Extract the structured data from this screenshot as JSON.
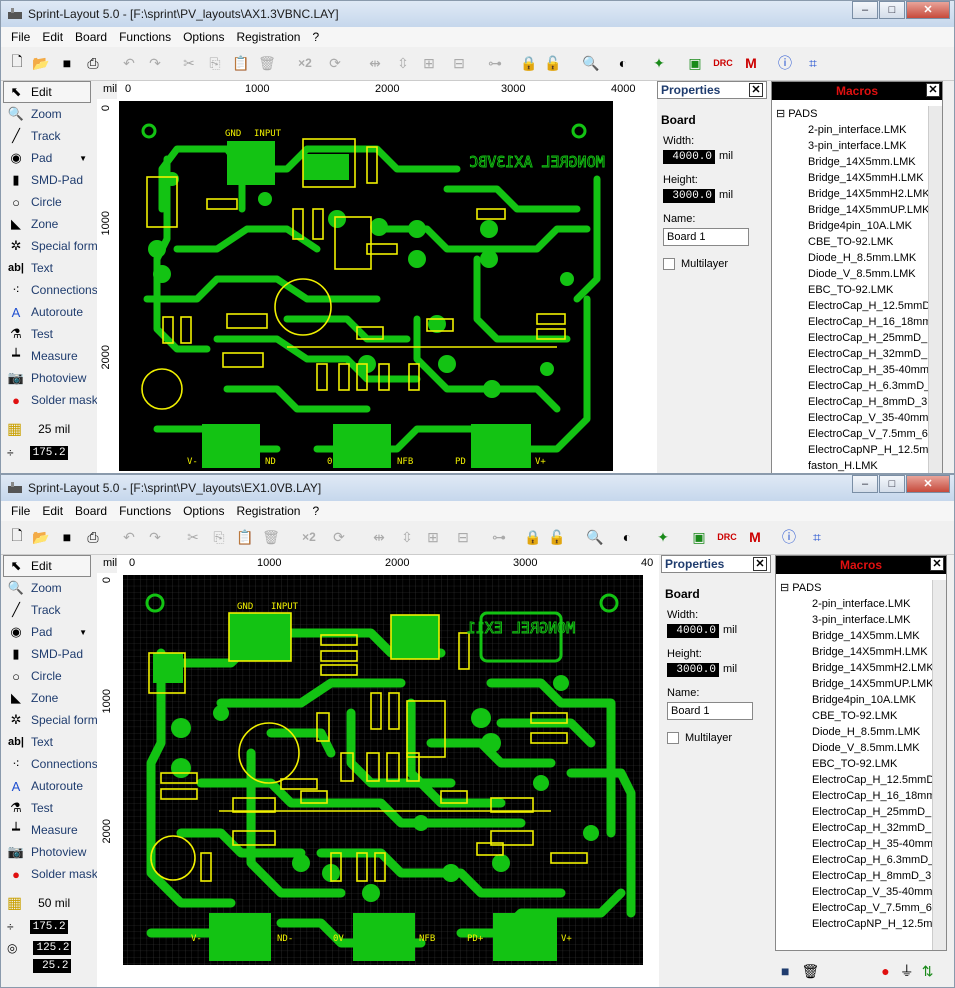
{
  "windows": [
    {
      "title": "Sprint-Layout 5.0 - [F:\\sprint\\PV_layouts\\AX1.3VBNC.LAY]",
      "menu": [
        "File",
        "Edit",
        "Board",
        "Functions",
        "Options",
        "Registration",
        "?"
      ],
      "tools": [
        {
          "label": "Edit",
          "icon": "arrow-cursor-icon"
        },
        {
          "label": "Zoom",
          "icon": "magnifier-icon"
        },
        {
          "label": "Track",
          "icon": "track-line-icon"
        },
        {
          "label": "Pad",
          "icon": "pad-icon"
        },
        {
          "label": "SMD-Pad",
          "icon": "smd-pad-icon"
        },
        {
          "label": "Circle",
          "icon": "circle-icon"
        },
        {
          "label": "Zone",
          "icon": "zone-icon"
        },
        {
          "label": "Special form",
          "icon": "special-form-icon"
        },
        {
          "label": "Text",
          "icon": "text-icon"
        },
        {
          "label": "Connections",
          "icon": "connections-icon"
        },
        {
          "label": "Autoroute",
          "icon": "autoroute-icon"
        },
        {
          "label": "Test",
          "icon": "test-icon"
        },
        {
          "label": "Measure",
          "icon": "measure-icon"
        },
        {
          "label": "Photoview",
          "icon": "camera-icon"
        },
        {
          "label": "Solder mask",
          "icon": "solder-mask-icon"
        }
      ],
      "grid": "25 mil",
      "track_width": "175.2",
      "ruler_unit": "mil",
      "hruler": [
        "0",
        "1000",
        "2000",
        "3000",
        "4000"
      ],
      "vruler": [
        "0",
        "1000",
        "2000"
      ],
      "properties": {
        "title": "Properties",
        "section": "Board",
        "width_label": "Width:",
        "width": "4000.0",
        "width_unit": "mil",
        "height_label": "Height:",
        "height": "3000.0",
        "height_unit": "mil",
        "name_label": "Name:",
        "name": "Board 1",
        "multilayer": "Multilayer"
      },
      "macros": {
        "title": "Macros",
        "root": "PADS",
        "items": [
          "2-pin_interface.LMK",
          "3-pin_interface.LMK",
          "Bridge_14X5mm.LMK",
          "Bridge_14X5mmH.LMK",
          "Bridge_14X5mmH2.LMK",
          "Bridge_14X5mmUP.LMK",
          "Bridge4pin_10A.LMK",
          "CBE_TO-92.LMK",
          "Diode_H_8.5mm.LMK",
          "Diode_V_8.5mm.LMK",
          "EBC_TO-92.LMK",
          "ElectroCap_H_12.5mmD",
          "ElectroCap_H_16_18mm",
          "ElectroCap_H_25mmD_",
          "ElectroCap_H_32mmD_",
          "ElectroCap_H_35-40mm",
          "ElectroCap_H_6.3mmD_",
          "ElectroCap_H_8mmD_3",
          "ElectroCap_V_35-40mm",
          "ElectroCap_V_7.5mm_6.",
          "ElectroCapNP_H_12.5m",
          "faston_H.LMK"
        ]
      },
      "pcb": {
        "top_labels": [
          "GND",
          "INPUT"
        ],
        "bottom_labels": [
          "V-",
          "ND",
          "0",
          "NFB",
          "PD",
          "V+"
        ],
        "mirror_text": "MONGREL AX13VBC"
      }
    },
    {
      "title": "Sprint-Layout 5.0 - [F:\\sprint\\PV_layouts\\EX1.0VB.LAY]",
      "menu": [
        "File",
        "Edit",
        "Board",
        "Functions",
        "Options",
        "Registration",
        "?"
      ],
      "grid": "50 mil",
      "track_width": "175.2",
      "val2": "125.2",
      "val3": "25.2",
      "ruler_unit": "mil",
      "hruler": [
        "0",
        "1000",
        "2000",
        "3000",
        "40"
      ],
      "vruler": [
        "0",
        "1000",
        "2000"
      ],
      "properties": {
        "title": "Properties",
        "section": "Board",
        "width_label": "Width:",
        "width": "4000.0",
        "width_unit": "mil",
        "height_label": "Height:",
        "height": "3000.0",
        "height_unit": "mil",
        "name_label": "Name:",
        "name": "Board 1",
        "multilayer": "Multilayer"
      },
      "macros": {
        "title": "Macros",
        "root": "PADS",
        "items": [
          "2-pin_interface.LMK",
          "3-pin_interface.LMK",
          "Bridge_14X5mm.LMK",
          "Bridge_14X5mmH.LMK",
          "Bridge_14X5mmH2.LMK",
          "Bridge_14X5mmUP.LMK",
          "Bridge4pin_10A.LMK",
          "CBE_TO-92.LMK",
          "Diode_H_8.5mm.LMK",
          "Diode_V_8.5mm.LMK",
          "EBC_TO-92.LMK",
          "ElectroCap_H_12.5mmD",
          "ElectroCap_H_16_18mm",
          "ElectroCap_H_25mmD_",
          "ElectroCap_H_32mmD_",
          "ElectroCap_H_35-40mm",
          "ElectroCap_H_6.3mmD_",
          "ElectroCap_H_8mmD_3",
          "ElectroCap_V_35-40mm",
          "ElectroCap_V_7.5mm_6.",
          "ElectroCapNP_H_12.5m"
        ]
      },
      "pcb": {
        "top_labels": [
          "GND",
          "INPUT"
        ],
        "bottom_labels": [
          "V-",
          "ND-",
          "0V",
          "NFB",
          "PD+",
          "V+"
        ],
        "mirror_text": "MONGREL EX11"
      }
    }
  ],
  "colors": {
    "copper": "#13c313",
    "silk": "#f0f000",
    "board": "#000000",
    "macros_title": "#e01010"
  }
}
